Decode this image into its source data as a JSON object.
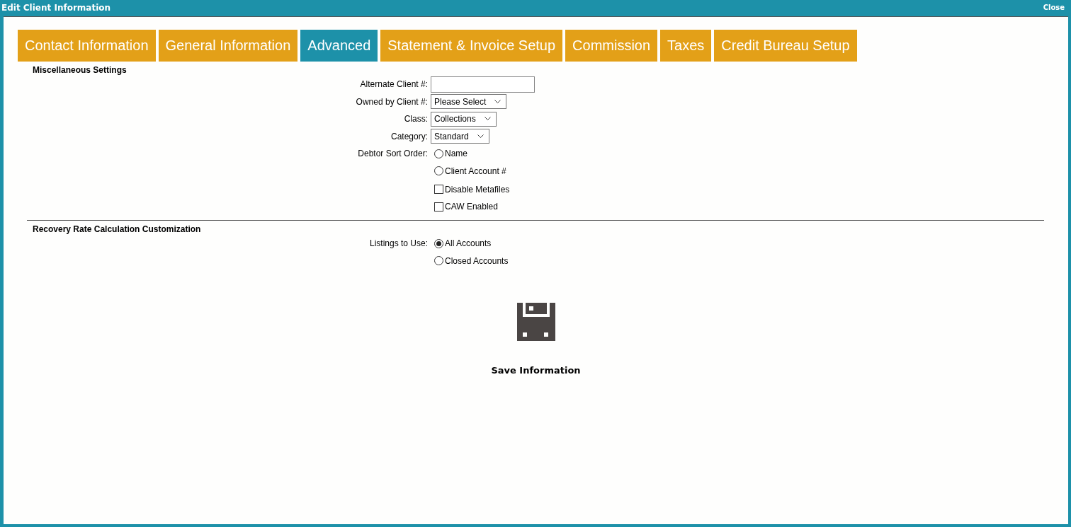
{
  "window": {
    "title": "Edit Client Information",
    "close": "Close"
  },
  "tabs": [
    {
      "label": "Contact Information",
      "selected": false
    },
    {
      "label": "General Information",
      "selected": false
    },
    {
      "label": "Advanced",
      "selected": true
    },
    {
      "label": "Statement & Invoice Setup",
      "selected": false
    },
    {
      "label": "Commission",
      "selected": false
    },
    {
      "label": "Taxes",
      "selected": false
    },
    {
      "label": "Credit Bureau Setup",
      "selected": false
    }
  ],
  "sections": [
    {
      "title": "Miscellaneous Settings",
      "rows": [
        {
          "kind": "text",
          "label": "Alternate Client #:"
        },
        {
          "kind": "select",
          "label": "Owned by Client #:",
          "value": "Please Select"
        },
        {
          "kind": "select",
          "label": "Class:",
          "value": "Collections"
        },
        {
          "kind": "select",
          "label": "Category:",
          "value": "Standard"
        },
        {
          "kind": "radio",
          "label": "Debtor Sort Order:",
          "options": [
            {
              "label": "Name",
              "selected": false
            },
            {
              "label": "Client Account #",
              "selected": false
            }
          ]
        },
        {
          "kind": "checkbox",
          "label": "Disable Metafiles",
          "checked": false
        },
        {
          "kind": "checkbox",
          "label": "CAW Enabled",
          "checked": false
        }
      ]
    },
    {
      "title": "Recovery Rate Calculation Customization",
      "rows": [
        {
          "kind": "radio",
          "label": "Listings to Use:",
          "options": [
            {
              "label": "All Accounts",
              "selected": true
            },
            {
              "label": "Closed Accounts",
              "selected": false
            }
          ]
        }
      ]
    }
  ],
  "save": {
    "label": "Save Information"
  }
}
